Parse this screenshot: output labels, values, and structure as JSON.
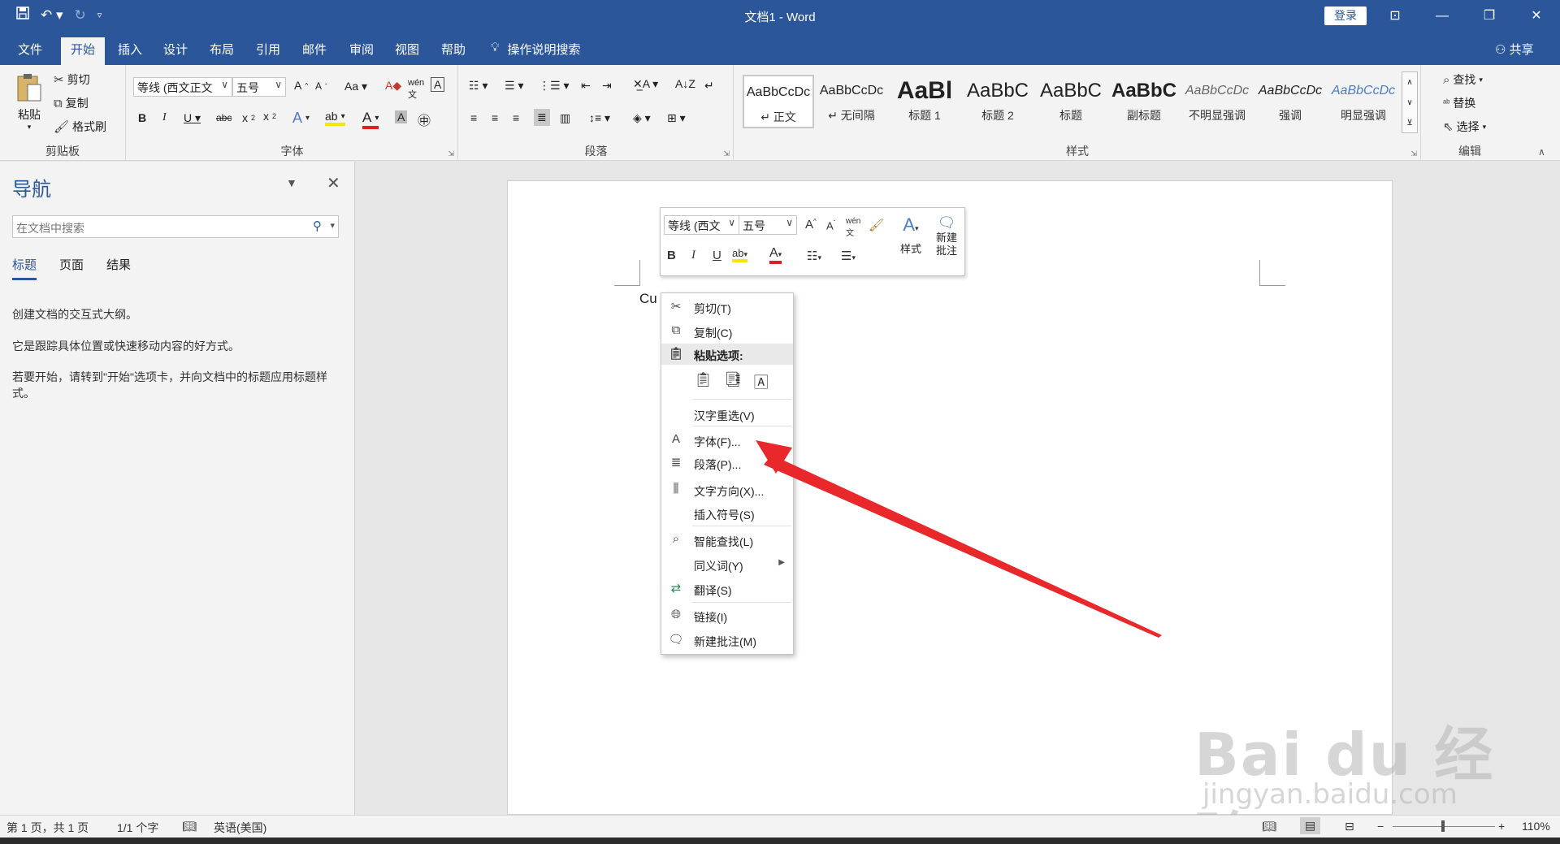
{
  "window": {
    "title": "文档1  -  Word",
    "login_label": "登录",
    "colors": {
      "brand": "#2b579a",
      "arrow": "#e8282b"
    }
  },
  "qat": {
    "save_icon": "save-icon",
    "undo_icon": "undo-icon",
    "redo_icon": "redo-icon"
  },
  "tabs": [
    "文件",
    "开始",
    "插入",
    "设计",
    "布局",
    "引用",
    "邮件",
    "审阅",
    "视图",
    "帮助"
  ],
  "tell_me": "操作说明搜索",
  "share_label": "共享",
  "ribbon": {
    "clipboard": {
      "paste": "粘贴",
      "cut": "剪切",
      "copy": "复制",
      "format_painter": "格式刷",
      "label": "剪贴板"
    },
    "font": {
      "font_name": "等线 (西文正文",
      "font_size": "五号",
      "label": "字体"
    },
    "paragraph": {
      "label": "段落"
    },
    "styles": {
      "label": "样式",
      "items": [
        {
          "preview": "AaBbCcDc",
          "name": "↵ 正文"
        },
        {
          "preview": "AaBbCcDc",
          "name": "↵ 无间隔"
        },
        {
          "preview": "AaBl",
          "name": "标题 1"
        },
        {
          "preview": "AaBbC",
          "name": "标题 2"
        },
        {
          "preview": "AaBbC",
          "name": "标题"
        },
        {
          "preview": "AaBbC",
          "name": "副标题"
        },
        {
          "preview": "AaBbCcDc",
          "name": "不明显强调"
        },
        {
          "preview": "AaBbCcDc",
          "name": "强调"
        },
        {
          "preview": "AaBbCcDc",
          "name": "明显强调"
        }
      ]
    },
    "editing": {
      "find": "查找",
      "replace": "替换",
      "select": "选择",
      "label": "编辑"
    }
  },
  "nav": {
    "title": "导航",
    "search_placeholder": "在文档中搜索",
    "tabs": [
      "标题",
      "页面",
      "结果"
    ],
    "text1": "创建文档的交互式大纲。",
    "text2": "它是跟踪具体位置或快速移动内容的好方式。",
    "text3": "若要开始，请转到\"开始\"选项卡，并向文档中的标题应用标题样式。"
  },
  "document": {
    "text": "Cu"
  },
  "mini_toolbar": {
    "font": "等线 (西文",
    "size": "五号",
    "styles": "样式",
    "new_comment": "新建\n批注"
  },
  "context_menu": {
    "cut": "剪切(T)",
    "copy": "复制(C)",
    "paste_options": "粘贴选项:",
    "reconvert": "汉字重选(V)",
    "font": "字体(F)...",
    "paragraph": "段落(P)...",
    "text_direction": "文字方向(X)...",
    "insert_symbol": "插入符号(S)",
    "smart_lookup": "智能查找(L)",
    "synonyms": "同义词(Y)",
    "translate": "翻译(S)",
    "link": "链接(I)",
    "new_comment": "新建批注(M)"
  },
  "status": {
    "page": "第 1 页，共 1 页",
    "words": "1/1 个字",
    "language": "英语(美国)",
    "zoom": "110%"
  },
  "watermark": {
    "line1": "Bai du 经验",
    "line2": "jingyan.baidu.com"
  }
}
